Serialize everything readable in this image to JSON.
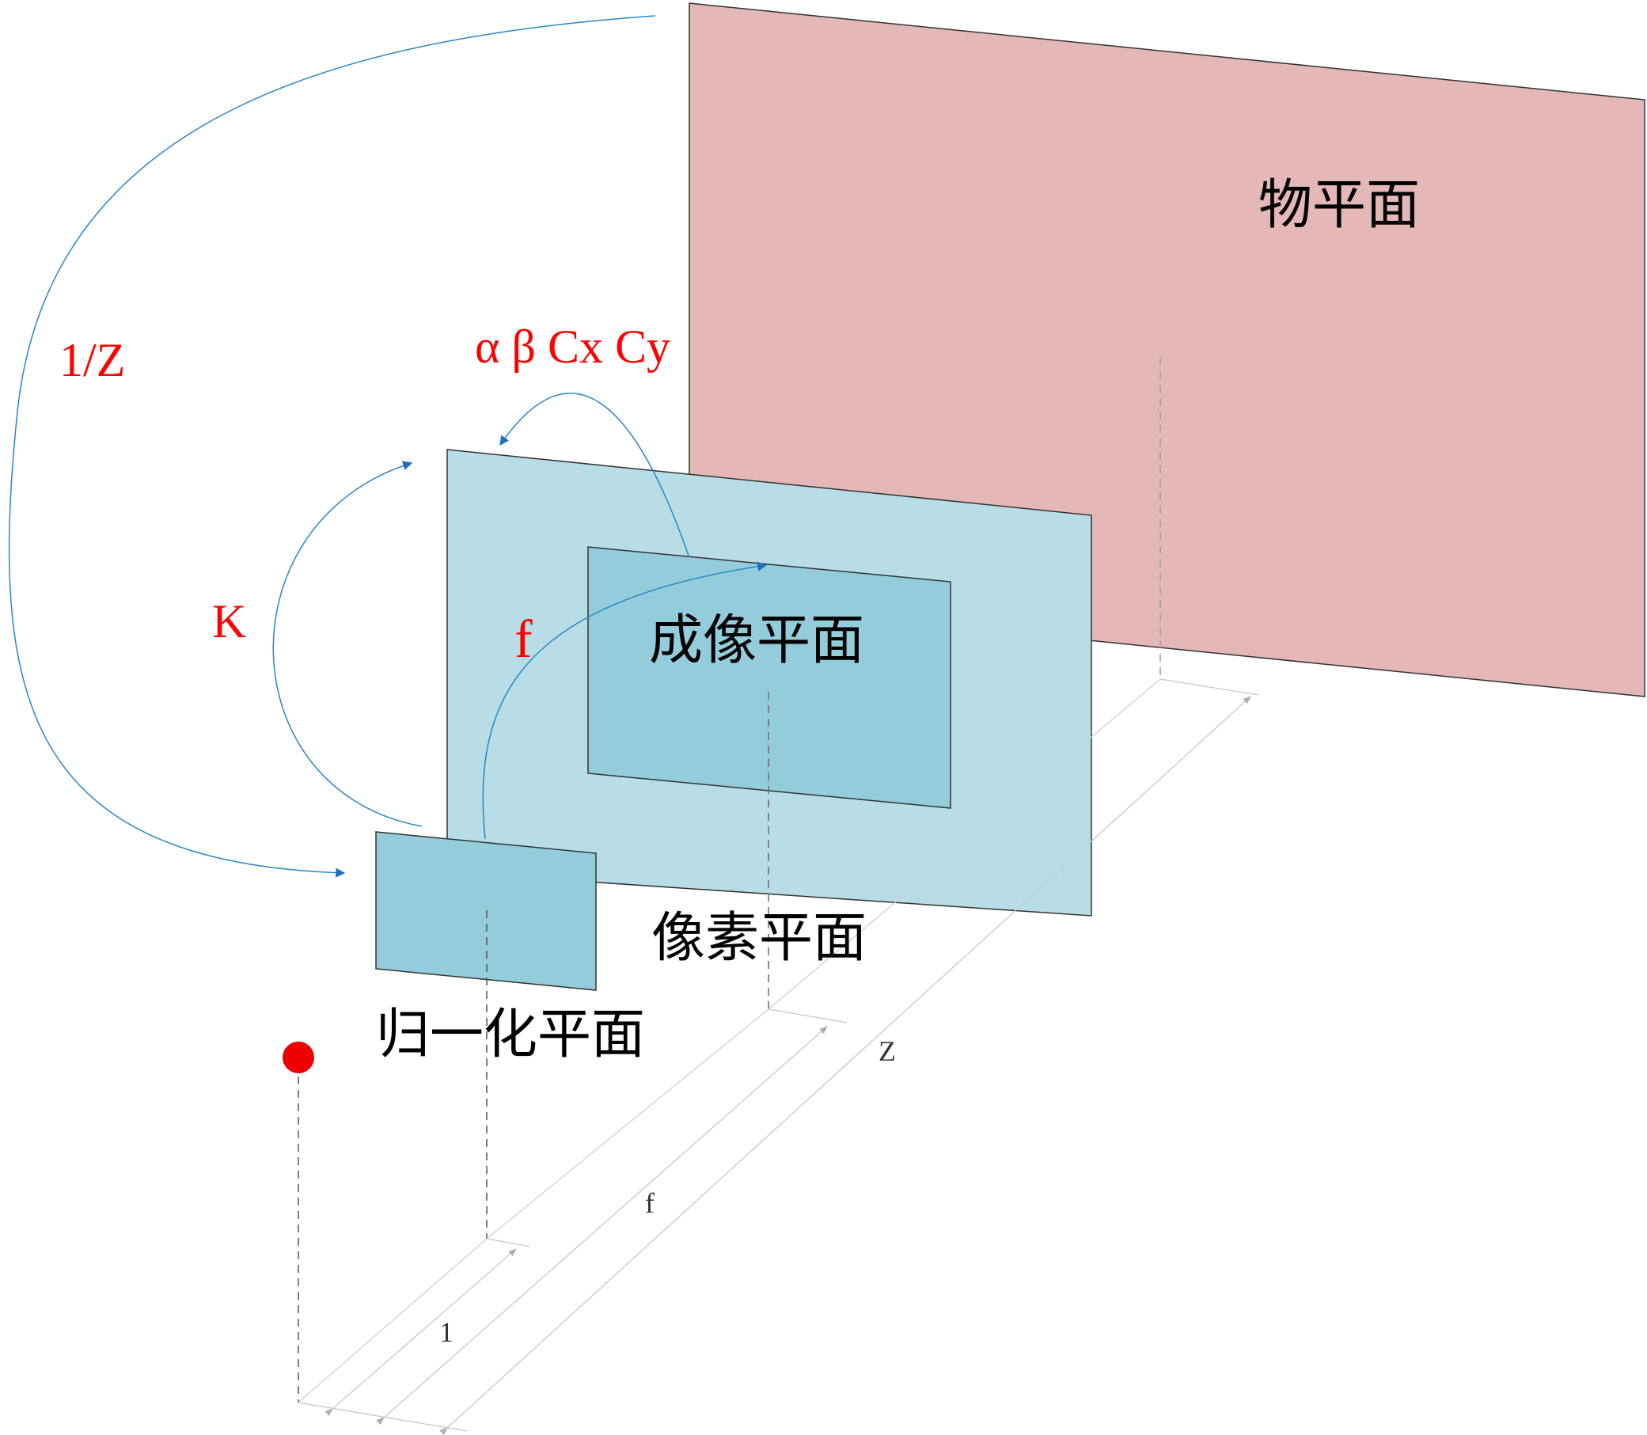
{
  "planes": {
    "object": {
      "label": "物平面"
    },
    "pixel": {
      "label": "像素平面"
    },
    "image": {
      "label": "成像平面"
    },
    "normalized": {
      "label": "归一化平面"
    }
  },
  "transforms": {
    "inv_z": {
      "label": "1/Z"
    },
    "intrinsics": {
      "label": "α β Cx Cy"
    },
    "k": {
      "label": "K"
    },
    "focal": {
      "label": "f"
    }
  },
  "dimensions": {
    "unit": {
      "label": "1"
    },
    "focal": {
      "label": "f"
    },
    "depth": {
      "label": "Z"
    }
  },
  "colors": {
    "object_plane": "#e4b8b6",
    "pixel_plane": "#b8dde7",
    "image_plane": "#93cddc",
    "normalized_plane": "#93cddc",
    "arrow": "#2a87c8",
    "arrowhead": "#1f6fc0",
    "param_text": "#ff0000",
    "optical_center": "#ee0000",
    "dim_line": "#c8c8c8",
    "dashed": "#777777"
  }
}
